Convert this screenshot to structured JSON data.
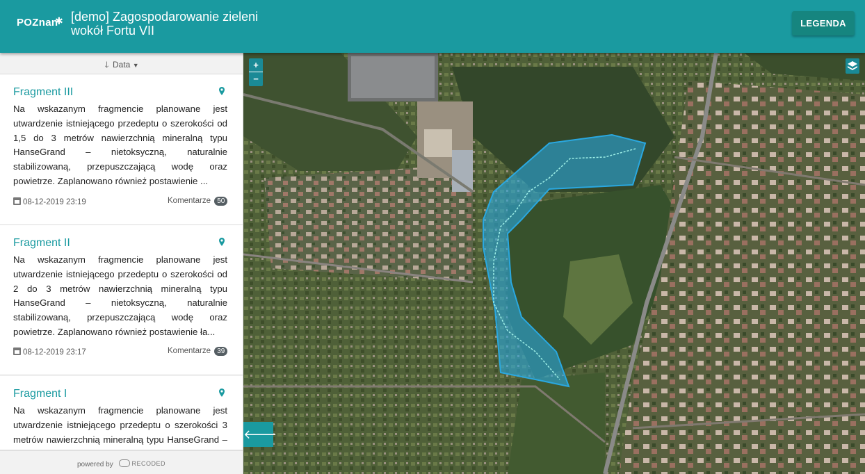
{
  "header": {
    "logo_text": "POZnan",
    "title_line1": "[demo] Zagospodarowanie zieleni",
    "title_line2": "wokół Fortu VII",
    "legend_label": "LEGENDA"
  },
  "sidebar": {
    "sort_label": "Data",
    "cards": [
      {
        "title": "Fragment III",
        "text": "Na wskazanym fragmencie planowane jest utwardzenie istniejącego przedeptu o szerokości od 1,5 do 3 metrów nawierzchnią mineralną typu HanseGrand – nietoksyczną, naturalnie stabilizowaną, przepuszczającą wodę oraz powietrze. Zaplanowano również postawienie ...",
        "date": "08-12-2019 23:19",
        "comments_label": "Komentarze",
        "comments_count": "50"
      },
      {
        "title": "Fragment II",
        "text": "Na wskazanym fragmencie planowane jest utwardzenie istniejącego przedeptu o szerokości od 2 do 3 metrów nawierzchnią mineralną typu HanseGrand – nietoksyczną, naturalnie stabilizowaną, przepuszczającą wodę oraz powietrze. Zaplanowano również postawienie ła...",
        "date": "08-12-2019 23:17",
        "comments_label": "Komentarze",
        "comments_count": "39"
      },
      {
        "title": "Fragment I",
        "text": "Na wskazanym fragmencie planowane jest utwardzenie istniejącego przedeptu o szerokości 3 metrów nawierzchnią mineralną typu HanseGrand – nietoksyczną, naturalnie stabilizowaną, przepuszczającą"
      }
    ],
    "footer_powered": "powered by",
    "footer_brand": "RECODED"
  },
  "map": {
    "zoom_in": "+",
    "zoom_out": "−",
    "back_arrow": "🡐"
  },
  "colors": {
    "primary": "#1a9aa0",
    "polygon": "#2aa8e0"
  }
}
